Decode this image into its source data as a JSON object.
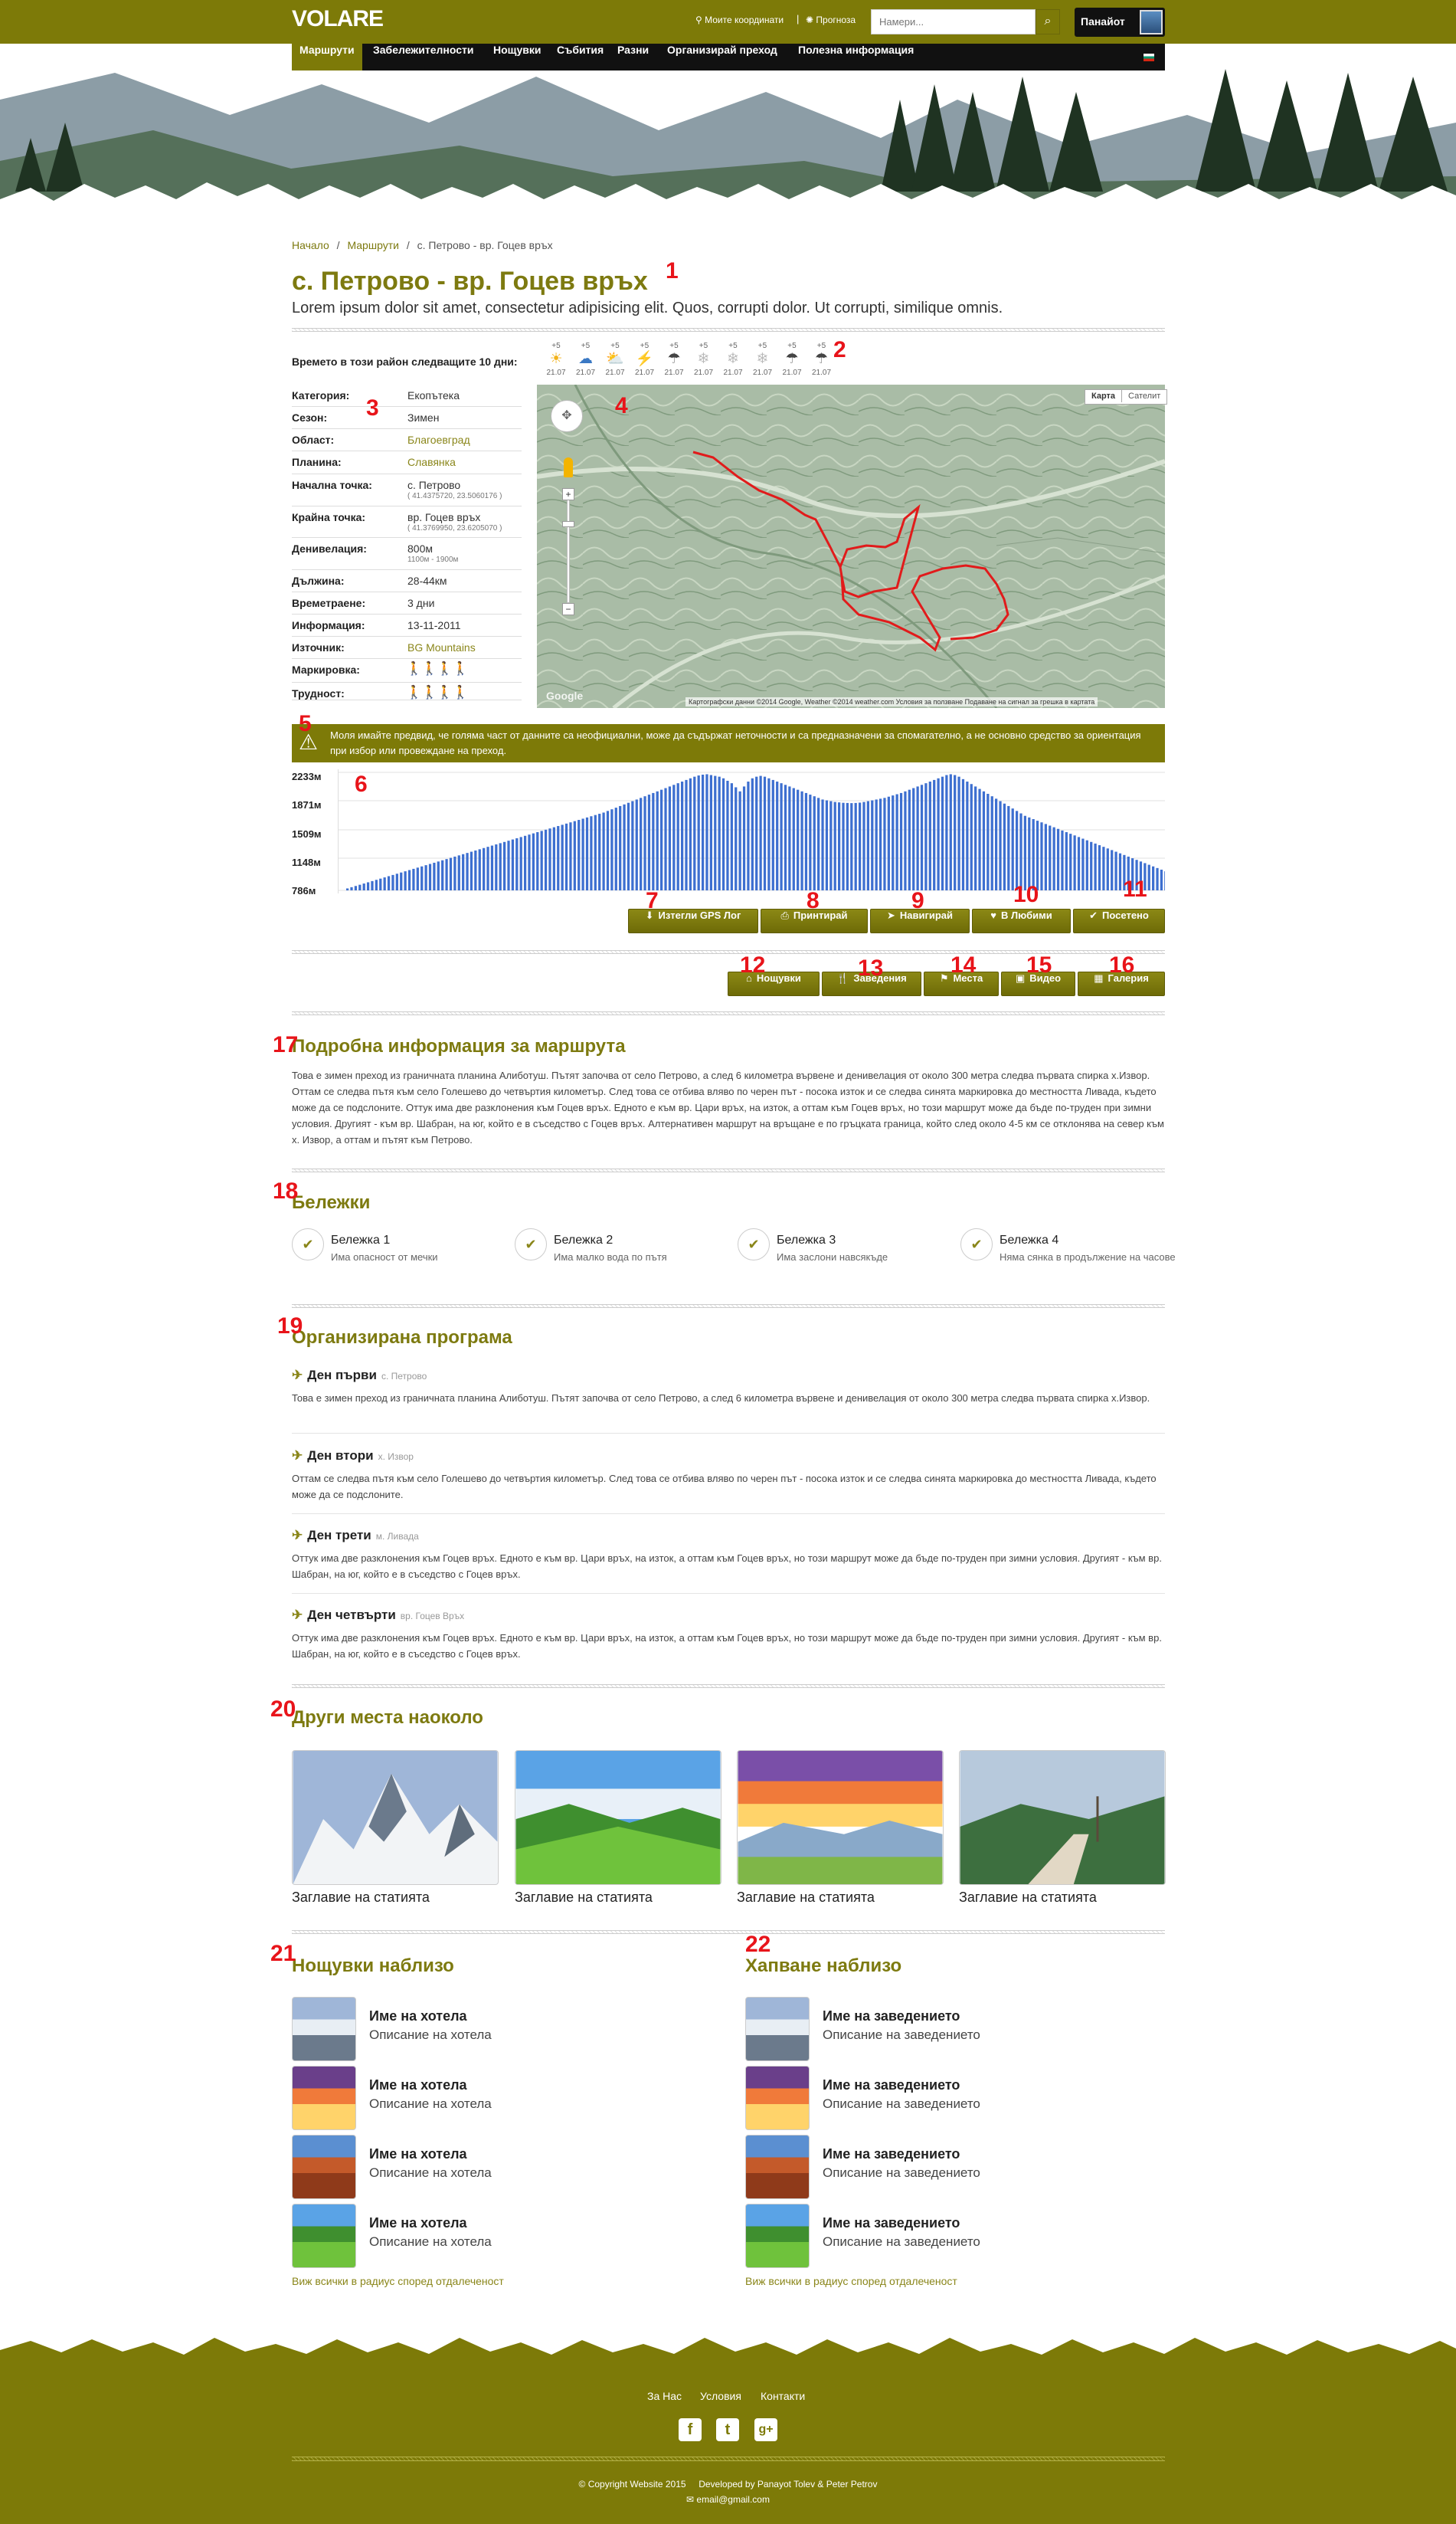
{
  "header": {
    "logo": "VOLARE",
    "coords_link": "Моите координати",
    "separator": "|",
    "forecast_link": "Прогноза",
    "search_placeholder": "Намери...",
    "user_name": "Панайот"
  },
  "nav": {
    "items": [
      "Маршрути",
      "Забележителности",
      "Нощувки",
      "Събития",
      "Разни",
      "Организирай преход",
      "Полезна информация"
    ]
  },
  "breadcrumb": [
    "Начало",
    "/",
    "Маршрути",
    "/",
    "с. Петрово - вр. Гоцев връх"
  ],
  "page": {
    "title": "с. Петрово - вр. Гоцев връх",
    "subtitle": "Lorem ipsum dolor sit amet, consectetur adipisicing elit. Quos, corrupti dolor. Ut corrupti, similique omnis."
  },
  "annotations": [
    "1",
    "2",
    "3",
    "4",
    "5",
    "6",
    "7",
    "8",
    "9",
    "10",
    "11",
    "12",
    "13",
    "14",
    "15",
    "16",
    "17",
    "18",
    "19",
    "20",
    "21",
    "22"
  ],
  "weather": {
    "label": "Времето в този район следващите 10 дни:",
    "days": [
      {
        "temp": "+5",
        "icon": "sun-icon",
        "glyph": "☀",
        "color": "#f2b21a",
        "date": "21.07"
      },
      {
        "temp": "+5",
        "icon": "cloud-icon",
        "glyph": "☁",
        "color": "#3b79c4",
        "date": "21.07"
      },
      {
        "temp": "+5",
        "icon": "cloud-sun-icon",
        "glyph": "⛅",
        "color": "#29a6d6",
        "date": "21.07"
      },
      {
        "temp": "+5",
        "icon": "lightning-icon",
        "glyph": "⚡",
        "color": "#d62020",
        "date": "21.07"
      },
      {
        "temp": "+5",
        "icon": "rain-cloud-icon",
        "glyph": "☂",
        "color": "#444444",
        "date": "21.07"
      },
      {
        "temp": "+5",
        "icon": "snow-icon",
        "glyph": "❄",
        "color": "#bbbbbb",
        "date": "21.07"
      },
      {
        "temp": "+5",
        "icon": "snow-icon",
        "glyph": "❄",
        "color": "#bbbbbb",
        "date": "21.07"
      },
      {
        "temp": "+5",
        "icon": "snow-icon",
        "glyph": "❄",
        "color": "#bbbbbb",
        "date": "21.07"
      },
      {
        "temp": "+5",
        "icon": "rain-cloud-icon",
        "glyph": "☂",
        "color": "#444444",
        "date": "21.07"
      },
      {
        "temp": "+5",
        "icon": "rain-cloud-icon",
        "glyph": "☂",
        "color": "#444444",
        "date": "21.07"
      }
    ]
  },
  "info": [
    {
      "label": "Категория:",
      "value": "Екопътека"
    },
    {
      "label": "Сезон:",
      "value": "Зимен"
    },
    {
      "label": "Област:",
      "value": "Благоевград",
      "link": true
    },
    {
      "label": "Планина:",
      "value": "Славянка",
      "link": true
    },
    {
      "label": "Начална точка:",
      "value": "с. Петрово",
      "sub": "( 41.4375720, 23.5060176 )"
    },
    {
      "label": "Крайна точка:",
      "value": "вр. Гоцев връх",
      "sub": "( 41.3769950, 23.6205070 )"
    },
    {
      "label": "Денивелация:",
      "value": "800м",
      "sub": "1100м - 1900м"
    },
    {
      "label": "Дължина:",
      "value": "28-44км"
    },
    {
      "label": "Времетраене:",
      "value": "3 дни"
    },
    {
      "label": "Информация:",
      "value": "13-11-2011"
    },
    {
      "label": "Източник:",
      "value": "BG Mountains",
      "link": true
    },
    {
      "label": "Маркировка:",
      "rating": 3,
      "max": 4
    },
    {
      "label": "Трудност:",
      "rating": 3,
      "max": 4
    }
  ],
  "map": {
    "type_buttons": [
      "Карта",
      "Сателит"
    ],
    "attribution": "Картографски данни ©2014 Google, Weather ©2014 weather.com   Условия за ползване   Подаване на сигнал за грешка в картата",
    "google": "Google",
    "route_color": "#e11b1b"
  },
  "warning": {
    "icon": "warning-icon",
    "text": "Моля имайте предвид, че голяма част от данните са неофициални, може да съдържат неточности и са предназначени за спомагателно, а не основно средство за ориентация при избор или провеждане на преход."
  },
  "elevation": {
    "y_ticks": [
      "2233м",
      "1871м",
      "1509м",
      "1148м",
      "786м"
    ],
    "y_range": [
      786,
      2233
    ],
    "bar_color": "#3d6fd0",
    "values": [
      810,
      825,
      840,
      855,
      870,
      885,
      900,
      915,
      930,
      945,
      960,
      975,
      990,
      1005,
      1020,
      1035,
      1050,
      1065,
      1080,
      1095,
      1110,
      1125,
      1140,
      1155,
      1170,
      1185,
      1200,
      1215,
      1230,
      1245,
      1260,
      1275,
      1290,
      1305,
      1320,
      1335,
      1350,
      1365,
      1380,
      1395,
      1410,
      1425,
      1440,
      1455,
      1470,
      1485,
      1500,
      1515,
      1530,
      1545,
      1560,
      1575,
      1590,
      1605,
      1620,
      1635,
      1650,
      1665,
      1680,
      1695,
      1710,
      1725,
      1740,
      1760,
      1780,
      1800,
      1820,
      1840,
      1860,
      1880,
      1900,
      1920,
      1940,
      1960,
      1980,
      2000,
      2020,
      2040,
      2060,
      2080,
      2100,
      2120,
      2140,
      2160,
      2180,
      2195,
      2205,
      2210,
      2200,
      2190,
      2180,
      2160,
      2130,
      2100,
      2050,
      2000,
      2060,
      2120,
      2160,
      2180,
      2190,
      2180,
      2160,
      2140,
      2120,
      2100,
      2080,
      2060,
      2040,
      2020,
      2000,
      1980,
      1960,
      1940,
      1920,
      1900,
      1890,
      1880,
      1870,
      1865,
      1860,
      1858,
      1856,
      1858,
      1862,
      1870,
      1880,
      1890,
      1900,
      1910,
      1920,
      1935,
      1950,
      1965,
      1980,
      2000,
      2020,
      2040,
      2060,
      2080,
      2100,
      2120,
      2140,
      2160,
      2180,
      2200,
      2210,
      2200,
      2180,
      2150,
      2120,
      2090,
      2060,
      2030,
      2000,
      1970,
      1940,
      1910,
      1880,
      1850,
      1820,
      1790,
      1760,
      1730,
      1700,
      1680,
      1660,
      1640,
      1620,
      1600,
      1580,
      1560,
      1540,
      1520,
      1500,
      1480,
      1460,
      1440,
      1420,
      1400,
      1380,
      1360,
      1340,
      1320,
      1300,
      1280,
      1260,
      1240,
      1220,
      1200,
      1180,
      1160,
      1140,
      1120,
      1100,
      1080,
      1060,
      1040,
      1020,
      1000
    ]
  },
  "actions": [
    {
      "label": "Изтегли GPS Лог",
      "icon": "download-icon",
      "glyph": "⬇"
    },
    {
      "label": "Принтирай",
      "icon": "print-icon",
      "glyph": "⎙"
    },
    {
      "label": "Навигирай",
      "icon": "navigate-icon",
      "glyph": "➤"
    },
    {
      "label": "В Любими",
      "icon": "heart-icon",
      "glyph": "♥"
    },
    {
      "label": "Посетено",
      "icon": "check-icon",
      "glyph": "✔"
    }
  ],
  "tabs": [
    {
      "label": "Нощувки",
      "icon": "home-icon",
      "glyph": "⌂"
    },
    {
      "label": "Заведения",
      "icon": "restaurant-icon",
      "glyph": "🍴"
    },
    {
      "label": "Места",
      "icon": "flag-icon",
      "glyph": "⚑"
    },
    {
      "label": "Видео",
      "icon": "film-icon",
      "glyph": "▣"
    },
    {
      "label": "Галерия",
      "icon": "picture-icon",
      "glyph": "▦"
    }
  ],
  "details": {
    "heading": "Подробна информация за маршрута",
    "text": "Това е зимен преход из граничната планина Алиботуш. Пътят започва от село Петрово, а след 6 километра вървене и денивелация от около 300 метра следва първата спирка х.Извор. Оттам се следва пътя към село Голешево до четвъртия километър. След това се отбива вляво по черен път - посока изток и се следва синята маркировка до местността Ливада, където може да се подслоните. Оттук има две разклонения към Гоцев връх. Едното е към вр. Цари връх, на изток, а оттам към Гоцев връх, но този маршрут може да бъде по-труден при зимни условия. Другият - към вр. Шабран, на юг, който е в съседство с Гоцев връх. Алтернативен маршрут на връщане е по гръцката граница, който след около 4-5 км се отклонява на север към х. Извор, а оттам и пътят към Петрово."
  },
  "notes": {
    "heading": "Бележки",
    "items": [
      {
        "title": "Бележка 1",
        "desc": "Има опасност от мечки"
      },
      {
        "title": "Бележка 2",
        "desc": "Има малко вода по пътя"
      },
      {
        "title": "Бележка 3",
        "desc": "Има заслони навсякъде"
      },
      {
        "title": "Бележка 4",
        "desc": "Няма сянка в продължение на часове"
      }
    ]
  },
  "program": {
    "heading": "Организирана програма",
    "days": [
      {
        "title": "Ден първи",
        "place": "с. Петрово",
        "text": "Това е зимен преход из граничната планина Алиботуш. Пътят започва от село Петрово, а след 6 километра вървене и денивелация от около 300 метра следва първата спирка х.Извор."
      },
      {
        "title": "Ден втори",
        "place": "х. Извор",
        "text": "Оттам се следва пътя към село Голешево до четвъртия километър. След това се отбива вляво по черен път - посока изток и се следва синята маркировка до местността Ливада, където може да се подслоните."
      },
      {
        "title": "Ден трети",
        "place": "м. Ливада",
        "text": "Оттук има две разклонения към Гоцев връх. Едното е към вр. Цари връх, на изток, а оттам към Гоцев връх, но този маршрут може да бъде по-труден при зимни условия. Другият - към вр. Шабран, на юг, който е в съседство с Гоцев връх."
      },
      {
        "title": "Ден четвърти",
        "place": "вр. Гоцев Връх",
        "text": "Оттук има две разклонения към Гоцев връх. Едното е към вр. Цари връх, на изток, а оттам към Гоцев връх, но този маршрут може да бъде по-труден при зимни условия. Другият - към вр. Шабран, на юг, който е в съседство с Гоцев връх."
      }
    ]
  },
  "places": {
    "heading": "Други места наоколо",
    "items": [
      {
        "caption": "Заглавие на статията"
      },
      {
        "caption": "Заглавие на статията"
      },
      {
        "caption": "Заглавие на статията"
      },
      {
        "caption": "Заглавие на статията"
      }
    ]
  },
  "lodging": {
    "heading": "Нощувки наблизо",
    "items": [
      {
        "title": "Име на хотела",
        "desc": "Описание на хотела"
      },
      {
        "title": "Име на хотела",
        "desc": "Описание на хотела"
      },
      {
        "title": "Име на хотела",
        "desc": "Описание на хотела"
      },
      {
        "title": "Име на хотела",
        "desc": "Описание на хотела"
      }
    ],
    "see_all": "Виж всички в радиус според отдалеченост"
  },
  "food": {
    "heading": "Хапване наблизо",
    "items": [
      {
        "title": "Име на заведението",
        "desc": "Описание на заведението"
      },
      {
        "title": "Име на заведението",
        "desc": "Описание на заведението"
      },
      {
        "title": "Име на заведението",
        "desc": "Описание на заведението"
      },
      {
        "title": "Име на заведението",
        "desc": "Описание на заведението"
      }
    ],
    "see_all": "Виж всички в радиус според отдалеченост"
  },
  "footer": {
    "links": [
      "За Нас",
      "Условия",
      "Контакти"
    ],
    "social": [
      {
        "icon": "facebook-icon",
        "glyph": "f"
      },
      {
        "icon": "twitter-icon",
        "glyph": "t"
      },
      {
        "icon": "google-plus-icon",
        "glyph": "g+"
      }
    ],
    "copyright": "© Copyright Website 2015     Developed by Panayot Tolev & Peter Petrov",
    "email": "email@gmail.com"
  },
  "colors": {
    "brand": "#7d7a08",
    "accent_text": "#7d7a10",
    "annotation": "#e8141a"
  }
}
